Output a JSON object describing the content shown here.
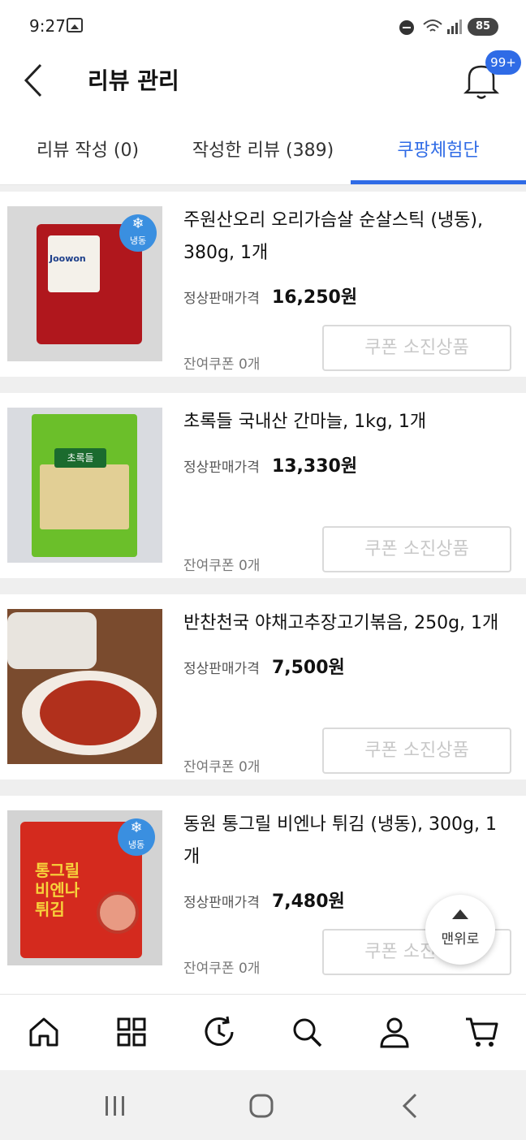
{
  "status_bar": {
    "time": "9:27",
    "battery": "85"
  },
  "header": {
    "title": "리뷰 관리",
    "notification_badge": "99+"
  },
  "tabs": [
    {
      "label": "리뷰 작성 (0)",
      "active": false
    },
    {
      "label": "작성한 리뷰 (389)",
      "active": false
    },
    {
      "label": "쿠팡체험단",
      "active": true
    }
  ],
  "items": [
    {
      "name": "주원산오리 오리가슴살 순살스틱 (냉동), 380g, 1개",
      "price_label": "정상판매가격",
      "price": "16,250원",
      "remaining": "잔여쿠폰 0개",
      "button_label": "쿠폰 소진상품",
      "frozen_label": "냉동",
      "logo": "Joowon"
    },
    {
      "name": "초록들 국내산 간마늘, 1kg, 1개",
      "price_label": "정상판매가격",
      "price": "13,330원",
      "remaining": "잔여쿠폰 0개",
      "button_label": "쿠폰 소진상품",
      "logo": "초록들"
    },
    {
      "name": "반찬천국 야채고추장고기볶음, 250g, 1개",
      "price_label": "정상판매가격",
      "price": "7,500원",
      "remaining": "잔여쿠폰 0개",
      "button_label": "쿠폰 소진상품"
    },
    {
      "name": "동원 통그릴 비엔나 튀김 (냉동), 300g, 1개",
      "price_label": "정상판매가격",
      "price": "7,480원",
      "remaining": "잔여쿠폰 0개",
      "button_label": "쿠폰 소진상품",
      "frozen_label": "냉동",
      "pack_title": "통그릴 비엔나 튀김"
    }
  ],
  "scroll_top": {
    "label": "맨위로"
  },
  "bottom_nav": [
    "home-icon",
    "categories-icon",
    "recent-icon",
    "search-icon",
    "account-icon",
    "cart-icon"
  ],
  "colors": {
    "accent": "#2f6be6",
    "disabled_text": "#c8c8c8"
  }
}
